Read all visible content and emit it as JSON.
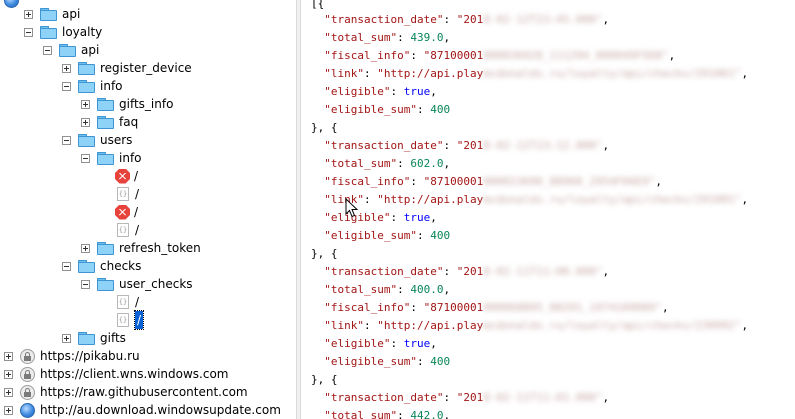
{
  "tree": {
    "api": "api",
    "loyalty": "loyalty",
    "loyalty_api": "api",
    "register_device": "register_device",
    "info": "info",
    "gifts_info": "gifts_info",
    "faq": "faq",
    "users": "users",
    "users_info": "info",
    "entry_slash": "/",
    "refresh_token": "refresh_token",
    "checks": "checks",
    "user_checks": "user_checks",
    "gifts": "gifts",
    "hosts": [
      "https://pikabu.ru",
      "https://client.wns.windows.com",
      "https://raw.githubusercontent.com",
      "http://au.download.windowsupdate.com"
    ]
  },
  "json": {
    "open": "[{",
    "sep": "}, {",
    "keys": {
      "transaction_date": "\"transaction_date\"",
      "total_sum": "\"total_sum\"",
      "fiscal_info": "\"fiscal_info\"",
      "link": "\"link\"",
      "eligible": "\"eligible\"",
      "eligible_sum": "\"eligible_sum\""
    },
    "date_prefix": "\"201",
    "fiscal_prefix": "\"87100001",
    "link_prefix": "\"http://api.play",
    "true_value": "true",
    "eligible_sum_value": "400",
    "totals": [
      "439.0",
      "602.0",
      "400.0",
      "442.0"
    ]
  }
}
